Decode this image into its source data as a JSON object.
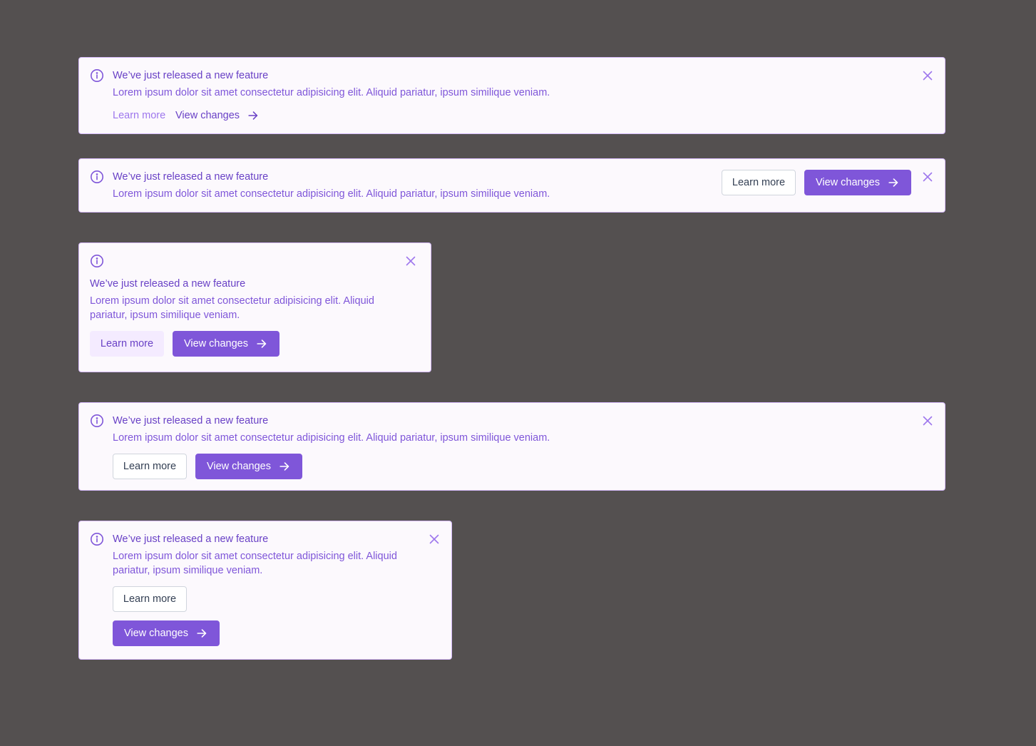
{
  "colors": {
    "background": "#545050",
    "alert_bg": "#fcf9fd",
    "alert_border": "#d6bbfb",
    "title": "#6941c6",
    "text": "#7f56d9",
    "primary_button": "#7f56d9"
  },
  "icons": {
    "info": "info-circle-icon",
    "close": "x-close-icon",
    "arrow": "arrow-right-icon"
  },
  "alerts": [
    {
      "title": "We’ve just released a new feature",
      "text": "Lorem ipsum dolor sit amet consectetur adipisicing elit. Aliquid pariatur, ipsum similique veniam.",
      "secondary_label": "Learn more",
      "primary_label": "View changes"
    },
    {
      "title": "We’ve just released a new feature",
      "text": "Lorem ipsum dolor sit amet consectetur adipisicing elit. Aliquid pariatur, ipsum similique veniam.",
      "secondary_label": "Learn more",
      "primary_label": "View changes"
    },
    {
      "title": "We’ve just released a new feature",
      "text": "Lorem ipsum dolor sit amet consectetur adipisicing elit. Aliquid pariatur, ipsum similique veniam.",
      "secondary_label": "Learn more",
      "primary_label": "View changes"
    },
    {
      "title": "We’ve just released a new feature",
      "text": "Lorem ipsum dolor sit amet consectetur adipisicing elit. Aliquid pariatur, ipsum similique veniam.",
      "secondary_label": "Learn more",
      "primary_label": "View changes"
    },
    {
      "title": "We’ve just released a new feature",
      "text": "Lorem ipsum dolor sit amet consectetur adipisicing elit. Aliquid pariatur, ipsum similique veniam.",
      "secondary_label": "Learn more",
      "primary_label": "View changes"
    }
  ]
}
